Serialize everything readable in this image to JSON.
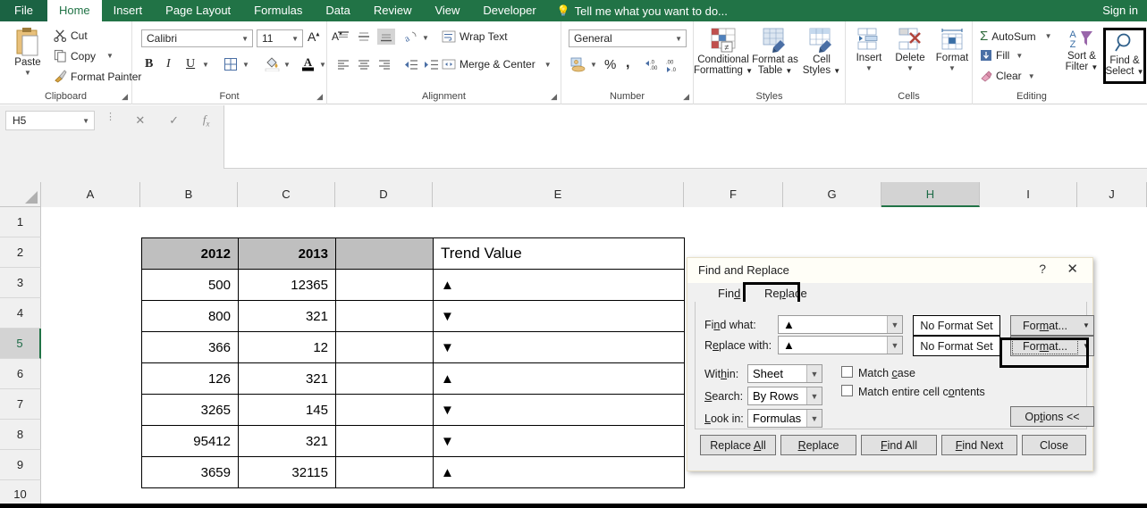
{
  "ribbon_tabs": [
    {
      "label": "File",
      "key": "file"
    },
    {
      "label": "Home",
      "key": "home"
    },
    {
      "label": "Insert",
      "key": "insert"
    },
    {
      "label": "Page Layout",
      "key": "page-layout"
    },
    {
      "label": "Formulas",
      "key": "formulas"
    },
    {
      "label": "Data",
      "key": "data"
    },
    {
      "label": "Review",
      "key": "review"
    },
    {
      "label": "View",
      "key": "view"
    },
    {
      "label": "Developer",
      "key": "developer"
    }
  ],
  "tellme": "Tell me what you want to do...",
  "signin": "Sign in",
  "groups": {
    "clipboard": {
      "label": "Clipboard",
      "paste": "Paste",
      "cut": "Cut",
      "copy": "Copy",
      "format_painter": "Format Painter"
    },
    "font": {
      "label": "Font",
      "font_name": "Calibri",
      "font_size": "11",
      "bold": "B",
      "italic": "I",
      "underline": "U"
    },
    "alignment": {
      "label": "Alignment",
      "wrap_text": "Wrap Text",
      "merge_center": "Merge & Center"
    },
    "number": {
      "label": "Number",
      "format": "General",
      "percent": "%",
      "comma": ","
    },
    "styles": {
      "label": "Styles",
      "conditional_formatting": "Conditional\nFormatting",
      "conditional_formatting_l1": "Conditional",
      "conditional_formatting_l2": "Formatting",
      "format_as_table_l1": "Format as",
      "format_as_table_l2": "Table",
      "cell_styles_l1": "Cell",
      "cell_styles_l2": "Styles"
    },
    "cells": {
      "label": "Cells",
      "insert": "Insert",
      "delete": "Delete",
      "format": "Format"
    },
    "editing": {
      "label": "Editing",
      "autosum": "AutoSum",
      "fill": "Fill",
      "clear": "Clear",
      "sort_filter_l1": "Sort &",
      "sort_filter_l2": "Filter",
      "find_select_l1": "Find &",
      "find_select_l2": "Select"
    }
  },
  "formula_bar": {
    "name_box": "H5",
    "formula_value": ""
  },
  "grid": {
    "columns": [
      "A",
      "B",
      "C",
      "D",
      "E",
      "F",
      "G",
      "H",
      "I",
      "J"
    ],
    "selected_column": "H",
    "rows": [
      "1",
      "2",
      "3",
      "4",
      "5",
      "6",
      "7",
      "8",
      "9",
      "10"
    ],
    "selected_row": "5"
  },
  "sheet_table": {
    "header": {
      "b": "2012",
      "c": "2013",
      "d": "",
      "e": "Trend Value"
    },
    "rows": [
      {
        "b": "500",
        "c": "12365",
        "d": "",
        "e": "▲"
      },
      {
        "b": "800",
        "c": "321",
        "d": "",
        "e": "▼"
      },
      {
        "b": "366",
        "c": "12",
        "d": "",
        "e": "▼"
      },
      {
        "b": "126",
        "c": "321",
        "d": "",
        "e": "▲"
      },
      {
        "b": "3265",
        "c": "145",
        "d": "",
        "e": "▼"
      },
      {
        "b": "95412",
        "c": "321",
        "d": "",
        "e": "▼"
      },
      {
        "b": "3659",
        "c": "32115",
        "d": "",
        "e": "▲"
      }
    ]
  },
  "dialog": {
    "title": "Find and Replace",
    "help": "?",
    "close": "✕",
    "tabs": [
      {
        "label": "Find",
        "active": false
      },
      {
        "label": "Replace",
        "active": true
      }
    ],
    "tab_find": "Find",
    "tab_replace": "Replace",
    "find_what_label": "Find what:",
    "find_what_value": "▲",
    "replace_with_label": "Replace with:",
    "replace_with_value": "▲",
    "no_format_set_1": "No Format Set",
    "no_format_set_2": "No Format Set",
    "format_btn_1": "Format...",
    "format_btn_2": "Format...",
    "within_label": "Within:",
    "within_value": "Sheet",
    "search_label": "Search:",
    "search_value": "By Rows",
    "look_in_label": "Look in:",
    "look_in_value": "Formulas",
    "match_case": "Match case",
    "match_entire": "Match entire cell contents",
    "options_btn": "Options <<",
    "replace_all": "Replace All",
    "replace": "Replace",
    "find_all": "Find All",
    "find_next": "Find Next",
    "close_btn": "Close"
  },
  "colors": {
    "excel_green": "#217346",
    "header_gray": "#bfbfbf",
    "selection_green": "#217346"
  }
}
